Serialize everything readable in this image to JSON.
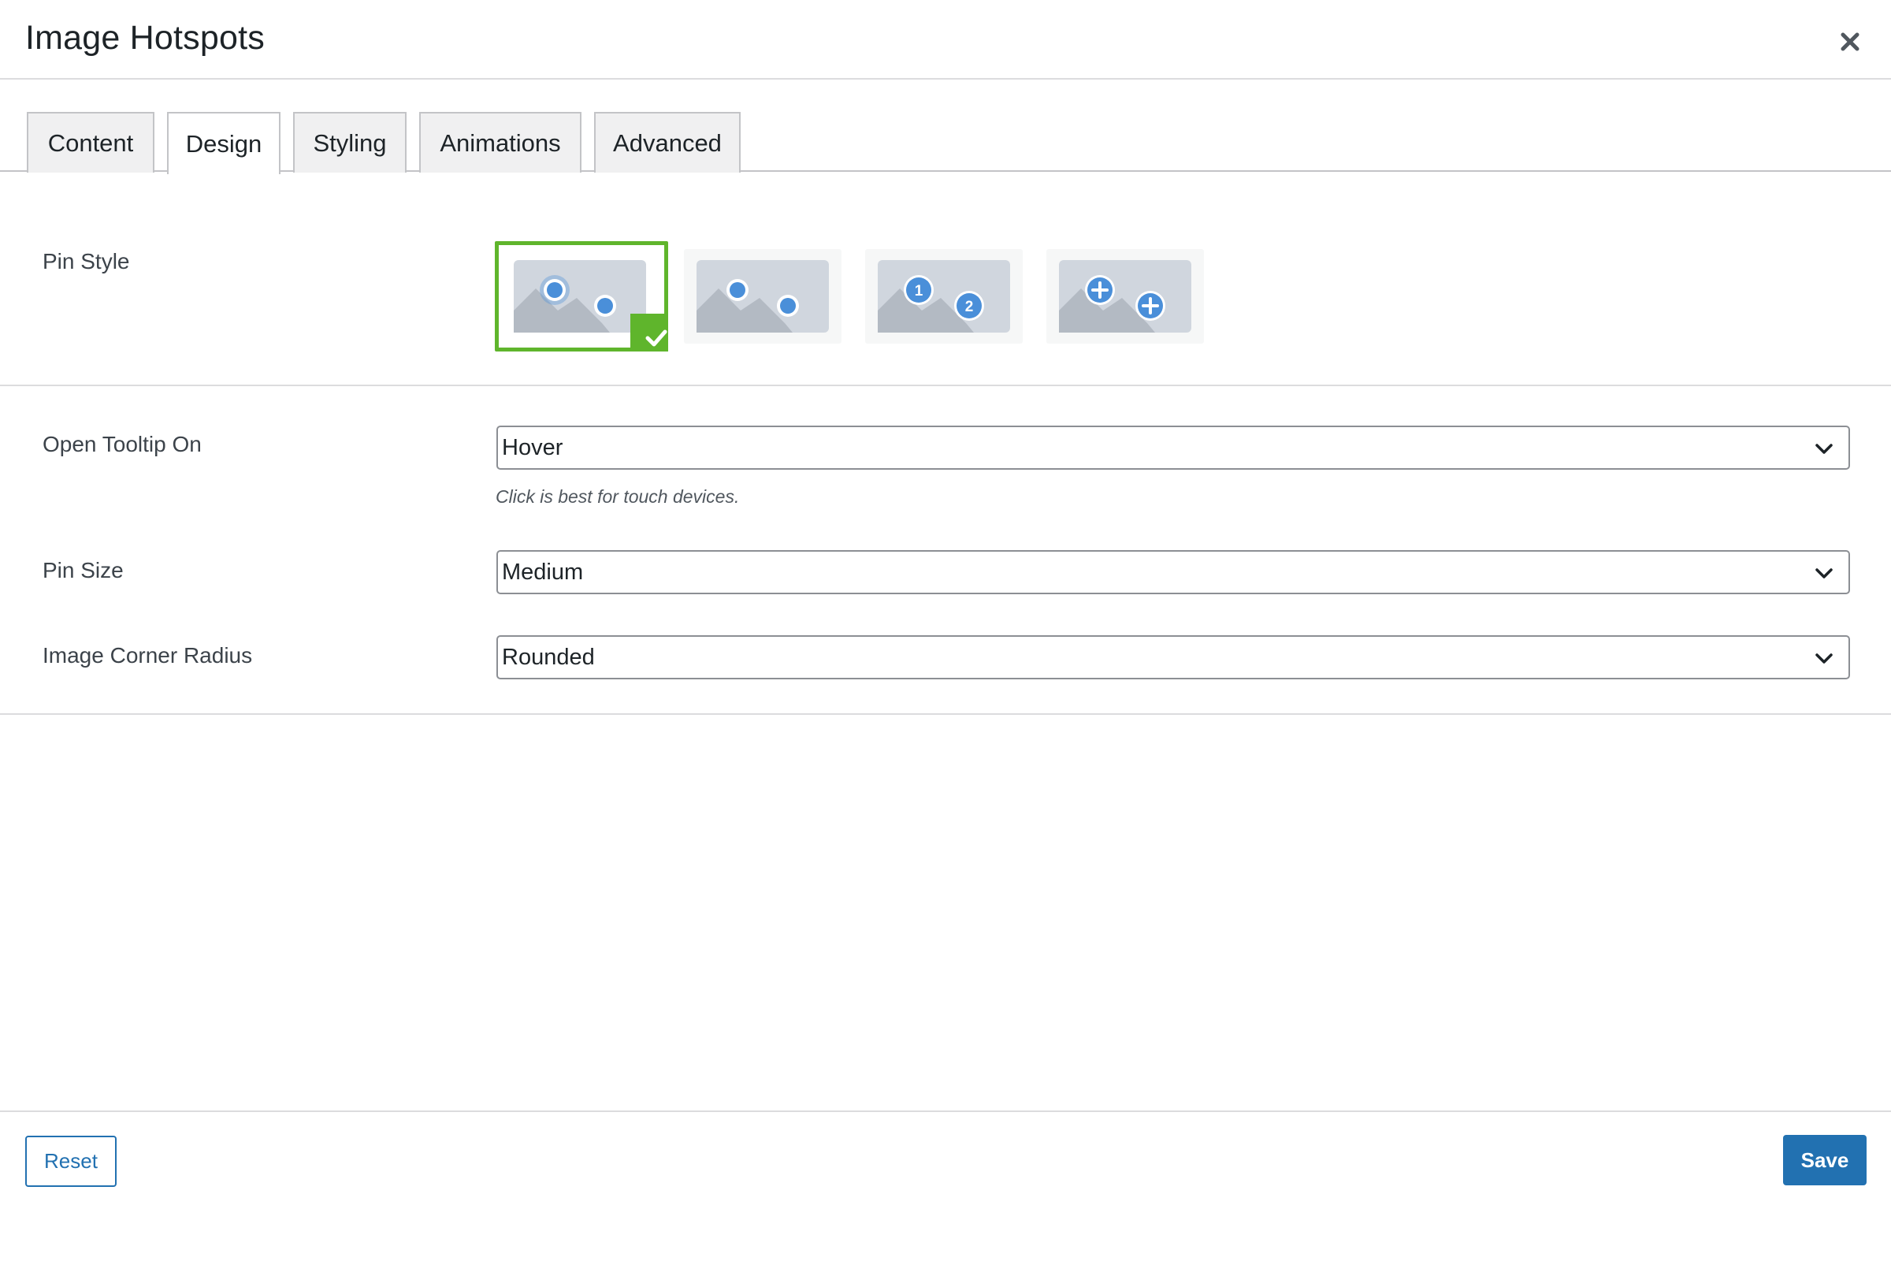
{
  "dialog": {
    "title": "Image Hotspots",
    "close_icon": "close-icon"
  },
  "tabs": [
    {
      "label": "Content",
      "active": false
    },
    {
      "label": "Design",
      "active": true
    },
    {
      "label": "Styling",
      "active": false
    },
    {
      "label": "Animations",
      "active": false
    },
    {
      "label": "Advanced",
      "active": false
    }
  ],
  "pin_style": {
    "label": "Pin Style",
    "options": [
      {
        "name": "pin-style-ring-dot",
        "selected": true
      },
      {
        "name": "pin-style-dot",
        "selected": false
      },
      {
        "name": "pin-style-numbered",
        "selected": false,
        "pins": [
          "1",
          "2"
        ]
      },
      {
        "name": "pin-style-plus",
        "selected": false
      }
    ]
  },
  "open_tooltip": {
    "label": "Open Tooltip On",
    "value": "Hover",
    "help": "Click is best for touch devices."
  },
  "pin_size": {
    "label": "Pin Size",
    "value": "Medium"
  },
  "corner_radius": {
    "label": "Image Corner Radius",
    "value": "Rounded"
  },
  "footer": {
    "reset_label": "Reset",
    "save_label": "Save"
  },
  "colors": {
    "accent": "#2271b1",
    "selected": "#5fb52c",
    "pin": "#4a8fd9",
    "thumb_bg": "#d0d6de",
    "mountain": "#b3bac3"
  }
}
